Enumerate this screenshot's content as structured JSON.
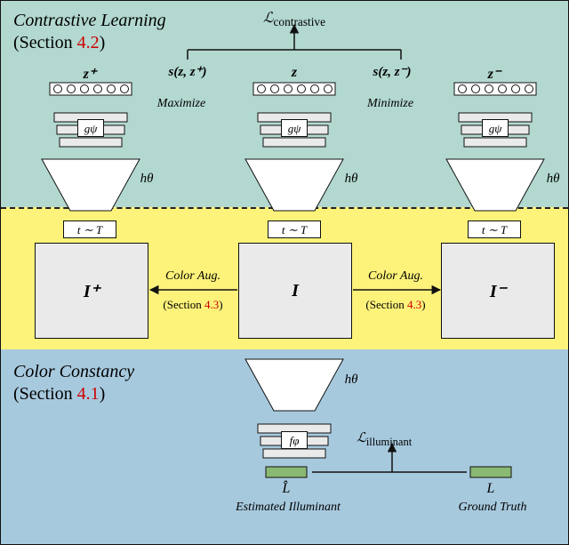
{
  "titles": {
    "contrastive_it": "Contrastive Learning",
    "contrastive_sec_prefix": "(Section ",
    "contrastive_sec_num": "4.2",
    "contrastive_sec_suffix": ")",
    "cc_it": "Color Constancy",
    "cc_sec_prefix": "(Section ",
    "cc_sec_num": "4.1",
    "cc_sec_suffix": ")"
  },
  "loss": {
    "contrastive": "ℒ",
    "contrastive_sub": "contrastive",
    "illuminant": "ℒ",
    "illuminant_sub": "illuminant"
  },
  "anno": {
    "maximize": "Maximize",
    "minimize": "Minimize",
    "s_pos": "s(z, z⁺)",
    "s_neg": "s(z, z⁻)",
    "z_left": "z⁺",
    "z_mid": "z",
    "z_right": "z⁻",
    "color_aug": "Color Aug.",
    "aug_sec_prefix": "(Section ",
    "aug_sec_num": "4.3",
    "aug_sec_suffix": ")"
  },
  "labels": {
    "g_psi": "gψ",
    "h_theta": "hθ",
    "f_phi": "fφ",
    "t_sample": "t ∼ T",
    "I_pos": "I⁺",
    "I_mid": "I",
    "I_neg": "I⁻",
    "L_hat": "L̂",
    "L_gt": "L",
    "est_illum": "Estimated Illuminant",
    "gt_illum": "Ground Truth"
  }
}
